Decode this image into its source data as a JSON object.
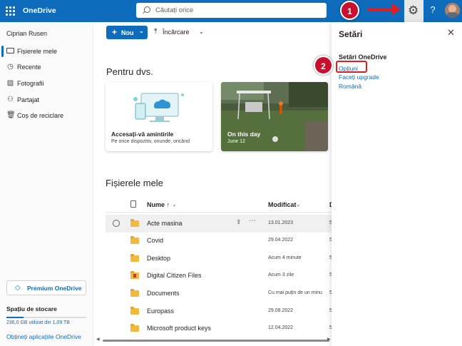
{
  "header": {
    "brand": "OneDrive",
    "search_placeholder": "Căutați orice",
    "help_label": "?"
  },
  "annotations": {
    "step1": "1",
    "step2": "2"
  },
  "sidebar": {
    "user_name": "Ciprian Rusen",
    "items": [
      {
        "label": "Fișierele mele",
        "icon": "folder-icon"
      },
      {
        "label": "Recente",
        "icon": "clock-icon"
      },
      {
        "label": "Fotografii",
        "icon": "image-icon"
      },
      {
        "label": "Partajat",
        "icon": "people-icon"
      },
      {
        "label": "Coș de reciclare",
        "icon": "trash-icon"
      }
    ],
    "premium_label": "Premium OneDrive",
    "storage_title": "Spațiu de stocare",
    "storage_text": "236,0 GB utilizat din 1,09 TB",
    "storage_fraction": 0.21,
    "get_apps": "Obțineți aplicațiile OneDrive"
  },
  "toolbar": {
    "new_label": "Nou",
    "upload_label": "Încărcare"
  },
  "for_you": {
    "heading": "Pentru dvs.",
    "card1_title": "Accesați-vă amintirile",
    "card1_subtitle": "Pe orice dispozitiv, oriunde, oricând",
    "card2_title": "On this day",
    "card2_subtitle": "June 12"
  },
  "files": {
    "heading": "Fișierele mele",
    "col_name": "Nume ↑",
    "col_modified": "Modificat",
    "col_trunc": "D",
    "rows": [
      {
        "name": "Acte masina",
        "modified": "13.01.2023",
        "extra": "5"
      },
      {
        "name": "Covid",
        "modified": "29.04.2022",
        "extra": "5"
      },
      {
        "name": "Desktop",
        "modified": "Acum 4 minute",
        "extra": "5"
      },
      {
        "name": "Digital Citizen Files",
        "modified": "Acum 3 zile",
        "extra": "5"
      },
      {
        "name": "Documents",
        "modified": "Cu mai puțin de un minu",
        "extra": "5"
      },
      {
        "name": "Europass",
        "modified": "29.08.2022",
        "extra": "5"
      },
      {
        "name": "Microsoft product keys",
        "modified": "12.04.2022",
        "extra": "5"
      }
    ]
  },
  "settings_panel": {
    "title": "Setări",
    "section_title": "Setări OneDrive",
    "links": [
      "Opțiuni",
      "Faceți upgrade",
      "Română"
    ]
  }
}
